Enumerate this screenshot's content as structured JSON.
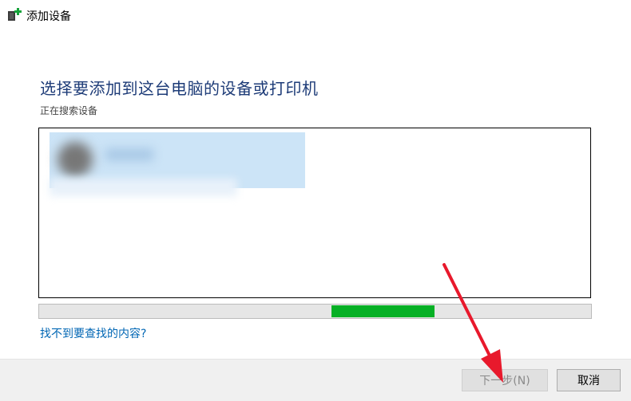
{
  "window": {
    "title": "添加设备"
  },
  "main": {
    "heading": "选择要添加到这台电脑的设备或打印机",
    "status": "正在搜索设备",
    "help_link": "找不到要查找的内容?",
    "progress": {
      "chunk_start": 0.53,
      "chunk_end": 0.717,
      "color": "#06b025"
    }
  },
  "footer": {
    "next_label": "下一步(N)",
    "cancel_label": "取消"
  },
  "colors": {
    "heading": "#1e3c78",
    "link": "#0066b4",
    "selection": "#cce4f7",
    "annotation_arrow": "#e8192c"
  }
}
